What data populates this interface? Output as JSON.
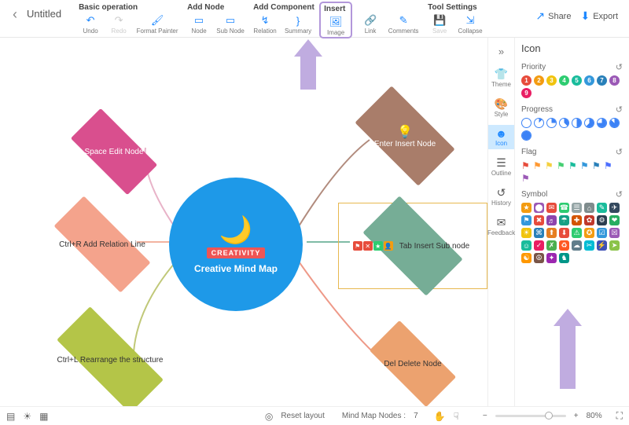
{
  "header": {
    "title": "Untitled",
    "share": "Share",
    "export": "Export"
  },
  "toolbar_groups": {
    "basic": {
      "head": "Basic operation",
      "undo": "Undo",
      "redo": "Redo",
      "fmt": "Format Painter"
    },
    "addnode": {
      "head": "Add Node",
      "node": "Node",
      "subnode": "Sub Node"
    },
    "addcomp": {
      "head": "Add Component",
      "relation": "Relation",
      "summary": "Summary"
    },
    "insert": {
      "head": "Insert",
      "image": "Image",
      "link": "Link",
      "comments": "Comments"
    },
    "tools": {
      "head": "Tool Settings",
      "save": "Save",
      "collapse": "Collapse"
    }
  },
  "rail": {
    "theme": "Theme",
    "style": "Style",
    "icon": "Icon",
    "outline": "Outline",
    "history": "History",
    "feedback": "Feedback"
  },
  "panel": {
    "title": "Icon",
    "priority": {
      "label": "Priority",
      "items": [
        "1",
        "2",
        "3",
        "4",
        "5",
        "6",
        "7",
        "8",
        "9"
      ],
      "colors": [
        "#e74c3c",
        "#f39c12",
        "#f1c40f",
        "#2ecc71",
        "#1abc9c",
        "#3498db",
        "#2980b9",
        "#9b59b6",
        "#e91e63"
      ]
    },
    "progress": {
      "label": "Progress"
    },
    "flag": {
      "label": "Flag",
      "colors": [
        "#e74c3c",
        "#ff9933",
        "#f4d03f",
        "#47cf73",
        "#1abc9c",
        "#3498db",
        "#2980b9",
        "#4d6fff",
        "#9b59b6"
      ]
    },
    "symbol": {
      "label": "Symbol"
    }
  },
  "nodes": {
    "center": "Creative Mind Map",
    "center_tag": "CREATIVITY",
    "left1": "Space Edit Node",
    "left2": "Ctrl+R Add Relation Line",
    "left3": "Ctrl+L Rearrange the structure",
    "right1": "Enter Insert Node",
    "right2": "Tab Insert Sub node",
    "right3": "Del Delete Node"
  },
  "status": {
    "reset": "Reset layout",
    "nodes_label": "Mind Map Nodes :",
    "nodes_count": "7",
    "zoom": "80%"
  }
}
